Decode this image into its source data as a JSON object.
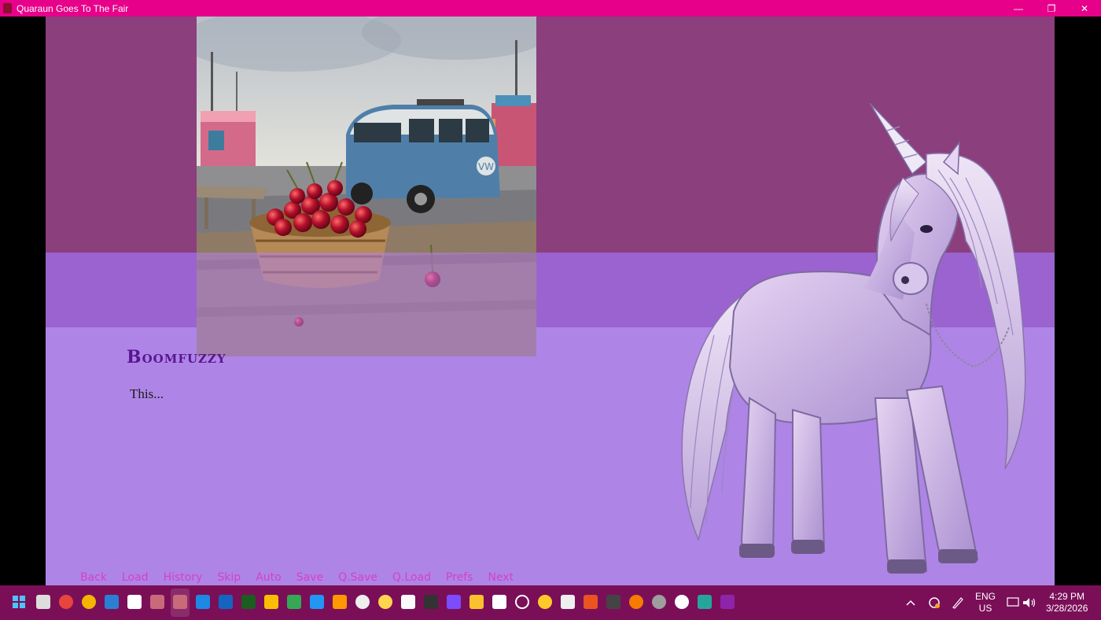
{
  "window": {
    "title": "Quaraun Goes To The Fair",
    "minimize_label": "—",
    "restore_label": "❐",
    "close_label": "✕"
  },
  "dialogue": {
    "speaker": "Boomfuzzy",
    "text": "This..."
  },
  "quick_menu": [
    "Back",
    "Load",
    "History",
    "Skip",
    "Auto",
    "Save",
    "Q.Save",
    "Q.Load",
    "Prefs",
    "Next"
  ],
  "taskbar": {
    "language_line1": "ENG",
    "language_line2": "US",
    "time": "4:29 PM",
    "date": "3/28/2026"
  },
  "colors": {
    "titlebar": "#e6008a",
    "top_band": "#8b3f7c",
    "mid_band": "#9b63cf",
    "textbox": "#ae85e6",
    "speaker_name": "#5a1590",
    "menu_text": "#d63fcb",
    "taskbar": "#7a0f58"
  },
  "icons": [
    "start-icon",
    "task-view-icon",
    "chrome-icon",
    "chrome-icon-2",
    "mail-icon",
    "pocket-icon",
    "game-icon",
    "game-icon-active",
    "vscode-icon",
    "notepad-icon",
    "terminal-icon",
    "gmail-icon",
    "sheets-icon",
    "photos-icon",
    "pencil-icon",
    "alien-icon",
    "emoji-icon",
    "clipboard-icon",
    "console-icon",
    "copilot-icon",
    "folder-icon",
    "file-icon",
    "chatgpt-icon",
    "wave-icon",
    "camera-icon",
    "ubuntu-icon",
    "cat-icon",
    "blender-icon",
    "settings-icon",
    "media-player-icon",
    "gallery-icon",
    "video-editor-icon"
  ]
}
